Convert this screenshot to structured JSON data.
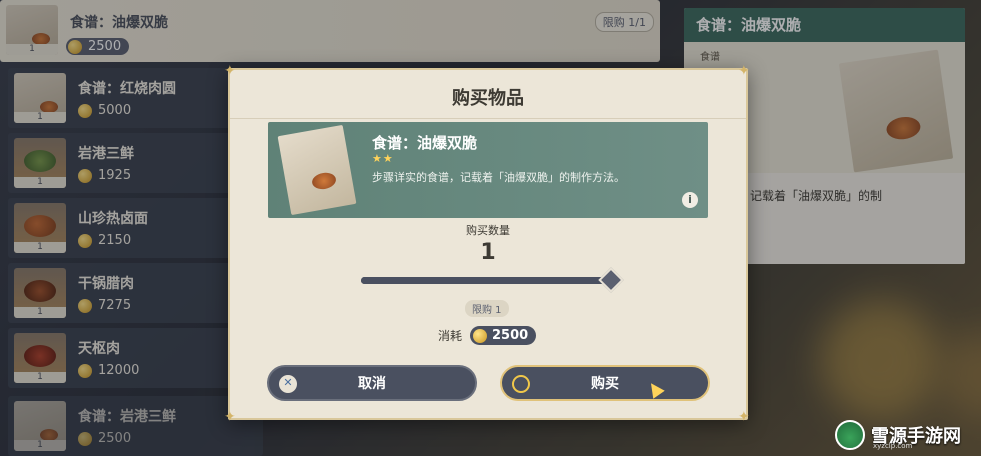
{
  "shop": {
    "items": [
      {
        "name": "食谱：油爆双脆",
        "price": "2500",
        "qty": "1",
        "limit": "限购 1/1"
      },
      {
        "name": "食谱：红烧肉圆",
        "price": "5000",
        "qty": "1"
      },
      {
        "name": "岩港三鲜",
        "price": "1925",
        "qty": "1"
      },
      {
        "name": "山珍热卤面",
        "price": "2150",
        "qty": "1"
      },
      {
        "name": "干锅腊肉",
        "price": "7275",
        "qty": "1"
      },
      {
        "name": "天枢肉",
        "price": "12000",
        "qty": "1"
      },
      {
        "name": "食谱：岩港三鲜",
        "price": "2500",
        "qty": "1"
      }
    ]
  },
  "detail": {
    "title": "食谱：油爆双脆",
    "type": "食谱",
    "description": "实的食谱，记载着「油爆双脆」的制"
  },
  "modal": {
    "title": "购买物品",
    "item_name": "食谱：油爆双脆",
    "stars": "★★",
    "description": "步骤详实的食谱，记载着「油爆双脆」的制作方法。",
    "quantity_label": "购买数量",
    "quantity": "1",
    "slider_fraction": 1.0,
    "limit": "限购 1",
    "cost_label": "消耗",
    "cost": "2500",
    "cancel_label": "取消",
    "buy_label": "购买",
    "info_icon": "i"
  },
  "watermark": {
    "name": "雪源手游网",
    "url": "xyzclp.com"
  },
  "colors": {
    "accent_green": "#3d6a5e",
    "panel_bg": "#ece6d8",
    "button_bg": "#4a5060",
    "gold": "#d4b56a"
  }
}
